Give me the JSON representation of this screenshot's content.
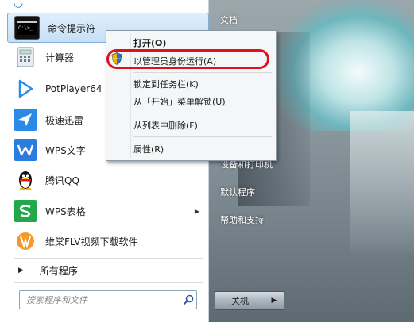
{
  "start_menu": {
    "items": [
      {
        "label": "命令提示符",
        "icon": "cmd-icon"
      },
      {
        "label": "计算器",
        "icon": "calculator-icon"
      },
      {
        "label": "PotPlayer64",
        "icon": "potplayer-icon"
      },
      {
        "label": "极速迅雷",
        "icon": "xunlei-icon"
      },
      {
        "label": "WPS文字",
        "icon": "wps-writer-icon"
      },
      {
        "label": "腾讯QQ",
        "icon": "qq-penguin-icon"
      },
      {
        "label": "WPS表格",
        "icon": "wps-spreadsheet-icon"
      },
      {
        "label": "维棠FLV视频下载软件",
        "icon": "weitang-icon"
      }
    ],
    "all_programs": "所有程序",
    "search_placeholder": "搜索程序和文件"
  },
  "right_column": {
    "documents": "文档",
    "devices": "设备和打印机",
    "default_programs": "默认程序",
    "help": "帮助和支持"
  },
  "shutdown": {
    "label": "关机"
  },
  "context_menu": {
    "open": "打开(O)",
    "run_as_admin": "以管理员身份运行(A)",
    "pin_taskbar": "锁定到任务栏(K)",
    "unpin_start": "从「开始」菜单解锁(U)",
    "remove_list": "从列表中删除(F)",
    "properties": "属性(R)"
  },
  "colors": {
    "highlight": "#e0101c",
    "selection": "#c7e0f7"
  }
}
